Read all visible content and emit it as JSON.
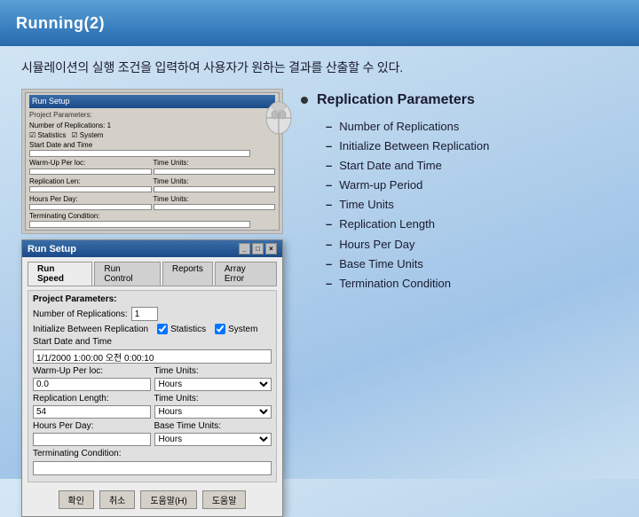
{
  "header": {
    "title": "Running(2)"
  },
  "subtitle": "시뮬레이션의 실행 조건을 입력하여 사용자가 원하는 결과를 산출할 수 있다.",
  "dialog": {
    "title": "Run Setup",
    "tabs": [
      "Run Speed",
      "Run Control",
      "Reports",
      "Array Error"
    ],
    "active_tab": "Run Speed",
    "sections": {
      "project_params": {
        "label": "Project Parameters:",
        "replication_label": "Number of Replications:",
        "replication_value": "1",
        "initialize_label": "Initialize Between Replication",
        "statistics_label": "Statistics",
        "system_label": "System",
        "start_date_label": "Start Date and Time",
        "start_date_value": "1/1/2000 1:00:00 오전 0:00:10",
        "warmup_label": "Warm-Up Per loc:",
        "warmup_value": "0.0",
        "warmup_units": "Hours",
        "replication_length_label": "Replication Length:",
        "replication_length_value": "54",
        "replication_length_units": "Hours",
        "hours_per_day_label": "Hours Per Day:",
        "hours_per_day_value": "",
        "hours_per_day_units": "Hours",
        "termination_label": "Terminating Condition:",
        "termination_value": ""
      }
    },
    "buttons": [
      "확인",
      "취소",
      "도움말(H)",
      "도움말"
    ]
  },
  "bullet_section": {
    "title": "Replication Parameters",
    "items": [
      "Number of Replications",
      "Initialize Between Replication",
      "Start Date and Time",
      "Warm-up Period",
      "Time Units",
      "Replication Length",
      "Hours Per Day",
      "Base Time Units",
      "Termination Condition"
    ]
  }
}
